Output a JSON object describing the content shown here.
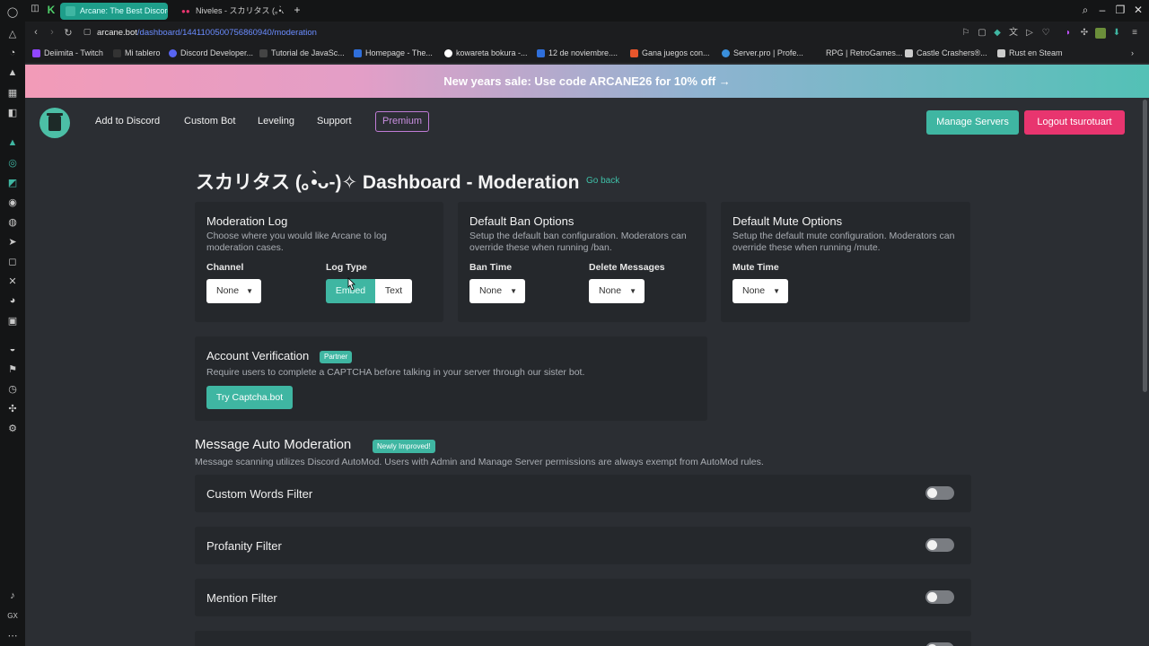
{
  "browser": {
    "tabs": [
      {
        "title": "Arcane: The Best Discord",
        "active": true
      },
      {
        "title": "Niveles - スカリタス (｡•̀ᴗ-)✧",
        "active": false
      }
    ],
    "new_tab": "+",
    "url_host": "arcane.bot",
    "url_path": "/dashboard/1441100500756860940/moderation",
    "bookmarks": [
      "Deiimita - Twitch",
      "Mi tablero",
      "Discord Developer...",
      "Tutorial de JavaSc...",
      "Homepage - The...",
      "kowareta bokura -...",
      "12 de noviembre....",
      "Gana juegos con...",
      "Server.pro | Profe...",
      "RPG | RetroGames...",
      "Castle Crashers®...",
      "Rust en Steam"
    ]
  },
  "promo": {
    "text": "New years sale: Use code ARCANE26 for 10% off →"
  },
  "nav": {
    "add_to_discord": "Add to Discord",
    "custom_bot": "Custom Bot",
    "leveling": "Leveling",
    "support": "Support",
    "premium": "Premium",
    "manage_servers": "Manage Servers",
    "logout": "Logout tsurotuart"
  },
  "page": {
    "title": "スカリタス (｡•̀ᴗ-)✧ Dashboard - Moderation",
    "go_back": "Go back"
  },
  "moderation_log": {
    "title": "Moderation Log",
    "desc": "Choose where you would like Arcane to log moderation cases.",
    "channel_label": "Channel",
    "channel_value": "None",
    "log_type_label": "Log Type",
    "log_type_options": [
      "Embed",
      "Text"
    ],
    "log_type_selected": "Embed"
  },
  "ban_options": {
    "title": "Default Ban Options",
    "desc": "Setup the default ban configuration. Moderators can override these when running /ban.",
    "ban_time_label": "Ban Time",
    "ban_time_value": "None",
    "delete_messages_label": "Delete Messages",
    "delete_messages_value": "None"
  },
  "mute_options": {
    "title": "Default Mute Options",
    "desc": "Setup the default mute configuration. Moderators can override these when running /mute.",
    "mute_time_label": "Mute Time",
    "mute_time_value": "None"
  },
  "verification": {
    "title": "Account Verification",
    "badge": "Partner",
    "desc": "Require users to complete a CAPTCHA before talking in your server through our sister bot.",
    "button": "Try Captcha.bot"
  },
  "automod": {
    "title": "Message Auto Moderation",
    "badge": "Newly Improved!",
    "desc": "Message scanning utilizes Discord AutoMod. Users with Admin and Manage Server permissions are always exempt from AutoMod rules.",
    "filters": [
      {
        "label": "Custom Words Filter",
        "enabled": false
      },
      {
        "label": "Profanity Filter",
        "enabled": false
      },
      {
        "label": "Mention Filter",
        "enabled": false
      }
    ]
  },
  "colors": {
    "accent": "#3fb6a2",
    "logout": "#e8356f",
    "premium": "#c98fe0",
    "card": "#25282c",
    "background": "#2b2e33"
  }
}
